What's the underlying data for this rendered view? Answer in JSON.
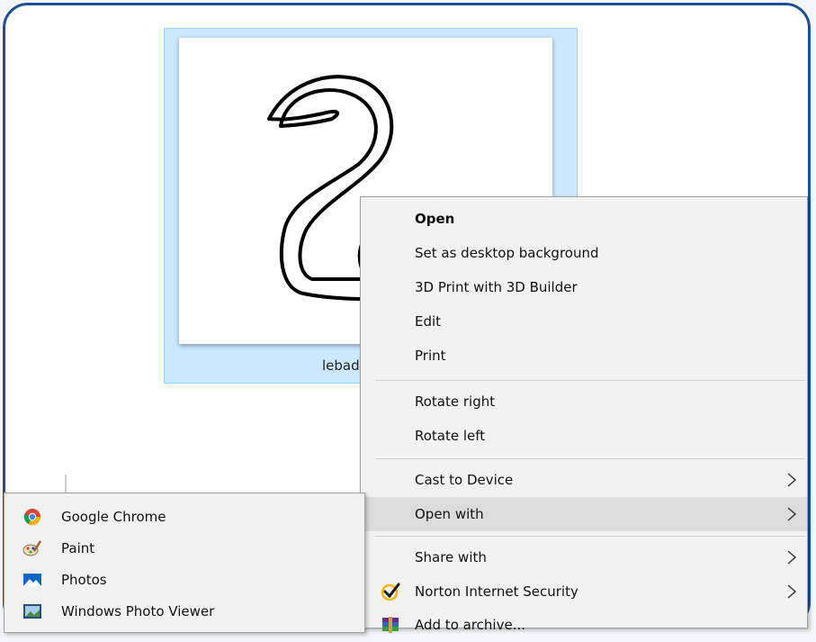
{
  "file": {
    "name": "lebad"
  },
  "context_menu": {
    "items": [
      {
        "label": "Open",
        "bold": true
      },
      {
        "label": "Set as desktop background"
      },
      {
        "label": "3D Print with 3D Builder"
      },
      {
        "label": "Edit"
      },
      {
        "label": "Print"
      },
      {
        "label": "Rotate right"
      },
      {
        "label": "Rotate left"
      },
      {
        "label": "Cast to Device",
        "submenu": true
      },
      {
        "label": "Open with",
        "submenu": true,
        "highlighted": true
      },
      {
        "label": "Share with",
        "submenu": true
      },
      {
        "label": "Norton Internet Security",
        "submenu": true,
        "icon": "norton-checkmark-icon"
      },
      {
        "label": "Add to archive...",
        "icon": "winrar-archive-icon"
      }
    ]
  },
  "open_with_submenu": {
    "items": [
      {
        "label": "Google Chrome",
        "icon": "chrome-icon"
      },
      {
        "label": "Paint",
        "icon": "paint-icon"
      },
      {
        "label": "Photos",
        "icon": "photos-icon"
      },
      {
        "label": "Windows Photo Viewer",
        "icon": "photo-viewer-icon"
      }
    ]
  },
  "colors": {
    "frame_border": "#1e4f95",
    "selection": "#cce8ff",
    "menu_background": "#f2f2f2",
    "menu_highlight": "#dcdcdc"
  }
}
